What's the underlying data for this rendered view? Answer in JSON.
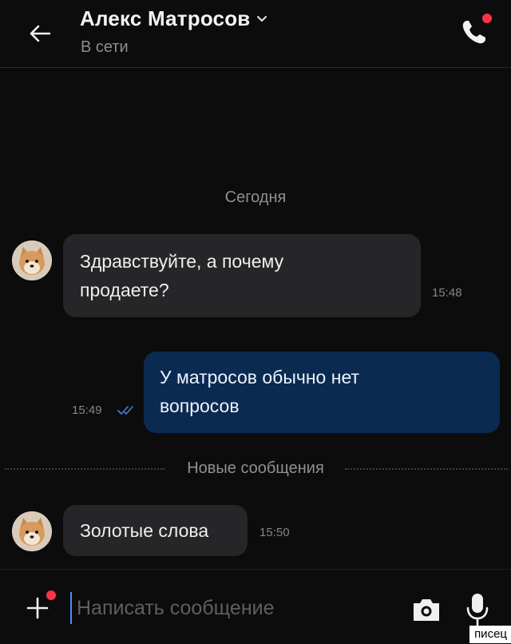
{
  "header": {
    "contact_name": "Алекс Матросов",
    "status": "В сети"
  },
  "chat": {
    "date_divider": "Сегодня",
    "messages": [
      {
        "direction": "incoming",
        "lines": [
          "Здравствуйте, а почему",
          "продаете?"
        ],
        "time": "15:48"
      },
      {
        "direction": "outgoing",
        "lines": [
          "У матросов обычно нет",
          "вопросов"
        ],
        "time": "15:49",
        "read": true
      },
      {
        "direction": "incoming",
        "lines": [
          "Золотые слова"
        ],
        "time": "15:50"
      }
    ],
    "new_messages_divider": "Новые сообщения"
  },
  "composer": {
    "placeholder": "Написать сообщение"
  },
  "colors": {
    "background": "#0c0c0d",
    "incoming_bubble": "#262628",
    "outgoing_bubble": "#0a2a52",
    "notification_dot": "#ff3347",
    "read_checks": "#4a7fd6"
  },
  "watermark": "писец"
}
